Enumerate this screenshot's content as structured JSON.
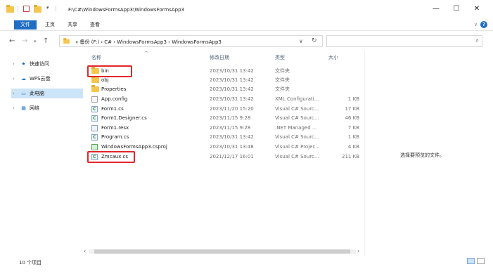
{
  "window": {
    "title_path": "F:\\C#\\WindowsFormsApp3\\WindowsFormsApp3",
    "minimize": "—",
    "maximize": "☐",
    "close": "✕"
  },
  "ribbon": {
    "tabs": [
      "文件",
      "主页",
      "共享",
      "查看"
    ],
    "help": "?"
  },
  "address": {
    "crumbs": "« 备份 (F:)  ›  C#  ›  WindowsFormsApp3  ›  WindowsFormsApp3",
    "search_placeholder": ""
  },
  "nav": {
    "items": [
      {
        "label": "快速访问",
        "icon": "star-icon"
      },
      {
        "label": "WPS云盘",
        "icon": "cloud-icon"
      },
      {
        "label": "此电脑",
        "icon": "computer-icon"
      },
      {
        "label": "网络",
        "icon": "network-icon"
      }
    ]
  },
  "columns": {
    "name": "名称",
    "date": "修改日期",
    "type": "类型",
    "size": "大小"
  },
  "files": [
    {
      "name": "bin",
      "date": "2023/10/31 13:42",
      "type": "文件夹",
      "size": "",
      "icon": "folder-icon"
    },
    {
      "name": "obj",
      "date": "2023/10/31 13:42",
      "type": "文件夹",
      "size": "",
      "icon": "folder-icon"
    },
    {
      "name": "Properties",
      "date": "2023/10/31 13:42",
      "type": "文件夹",
      "size": "",
      "icon": "folder-icon"
    },
    {
      "name": "App.config",
      "date": "2023/10/31 13:42",
      "type": "XML Configurati...",
      "size": "1 KB",
      "icon": "config-file-icon"
    },
    {
      "name": "Form1.cs",
      "date": "2023/11/20 15:20",
      "type": "Visual C# Sourc...",
      "size": "17 KB",
      "icon": "cs-file-icon"
    },
    {
      "name": "Form1.Designer.cs",
      "date": "2023/11/15 9:28",
      "type": "Visual C# Sourc...",
      "size": "46 KB",
      "icon": "cs-file-icon"
    },
    {
      "name": "Form1.resx",
      "date": "2023/11/15 9:28",
      "type": ".NET Managed ...",
      "size": "7 KB",
      "icon": "resx-file-icon"
    },
    {
      "name": "Program.cs",
      "date": "2023/10/31 13:42",
      "type": "Visual C# Sourc...",
      "size": "1 KB",
      "icon": "cs-file-icon"
    },
    {
      "name": "WindowsFormsApp3.csproj",
      "date": "2023/10/31 13:48",
      "type": "Visual C# Projec...",
      "size": "4 KB",
      "icon": "csproj-file-icon"
    },
    {
      "name": "Zmcaux.cs",
      "date": "2021/12/17 16:01",
      "type": "Visual C# Sourc...",
      "size": "211 KB",
      "icon": "cs-file-icon"
    }
  ],
  "preview": {
    "empty_text": "选择要预览的文件。"
  },
  "status": {
    "count": "10 个项目"
  },
  "colors": {
    "accent": "#1f6dc5",
    "selection": "#cce4f7",
    "highlight": "#e2262b",
    "folder": "#f3c64f"
  }
}
